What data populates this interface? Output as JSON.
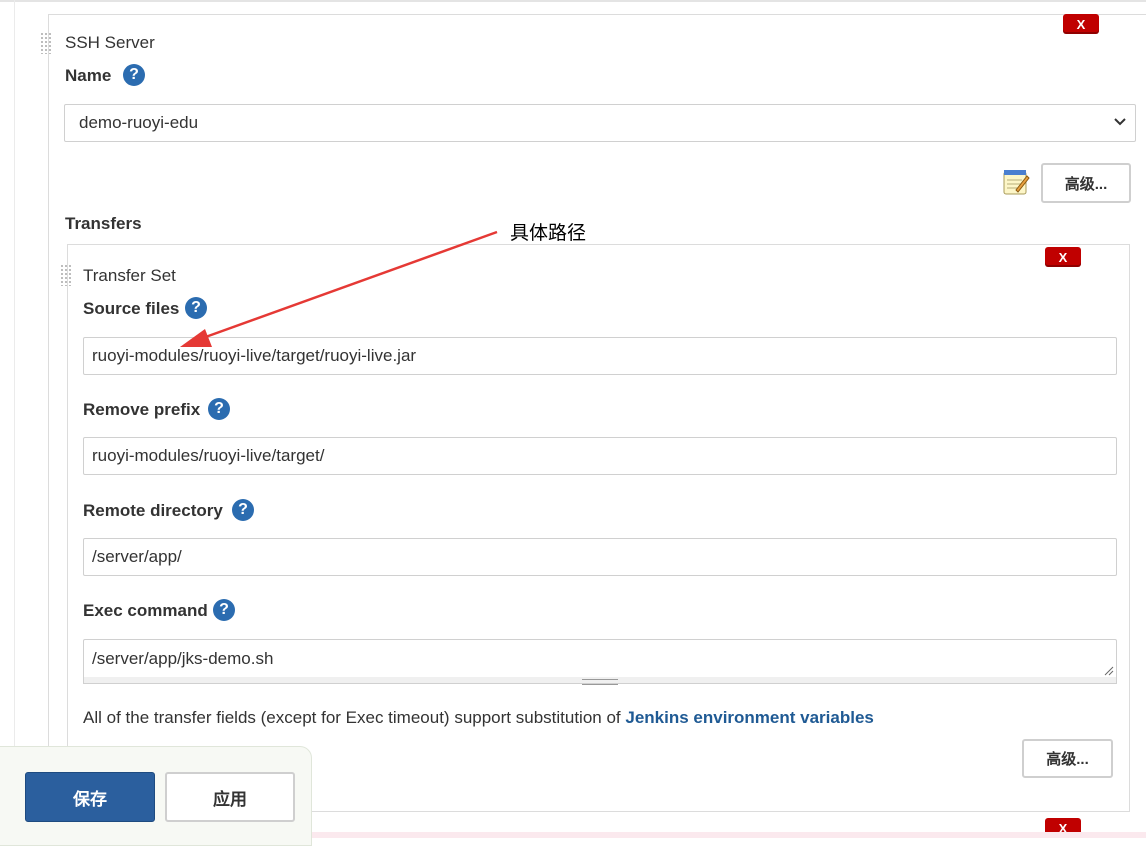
{
  "ssh_server": {
    "title": "SSH Server",
    "name_label": "Name",
    "name_value": "demo-ruoyi-edu",
    "advanced_label": "高级...",
    "delete_label": "X"
  },
  "transfers": {
    "section_label": "Transfers",
    "transfer_set": {
      "title": "Transfer Set",
      "delete_label": "X",
      "source_files_label": "Source files",
      "source_files_value": "ruoyi-modules/ruoyi-live/target/ruoyi-live.jar",
      "remove_prefix_label": "Remove prefix",
      "remove_prefix_value": "ruoyi-modules/ruoyi-live/target/",
      "remote_directory_label": "Remote directory",
      "remote_directory_value": "/server/app/",
      "exec_command_label": "Exec command",
      "exec_command_value": "/server/app/jks-demo.sh",
      "info_text": "All of the transfer fields (except for Exec timeout) support substitution of ",
      "info_link": "Jenkins environment variables",
      "advanced_label": "高级..."
    },
    "next_delete_label": "X"
  },
  "annotation": {
    "text": "具体路径",
    "arrow_color": "#e53935"
  },
  "footer": {
    "save_label": "保存",
    "apply_label": "应用"
  },
  "icons": {
    "help": "?",
    "chevron": "⌄"
  },
  "colors": {
    "accent_blue": "#2b6cb0",
    "delete_red": "#c00000",
    "link_blue": "#1f5a94",
    "save_blue": "#2b5f9e"
  }
}
